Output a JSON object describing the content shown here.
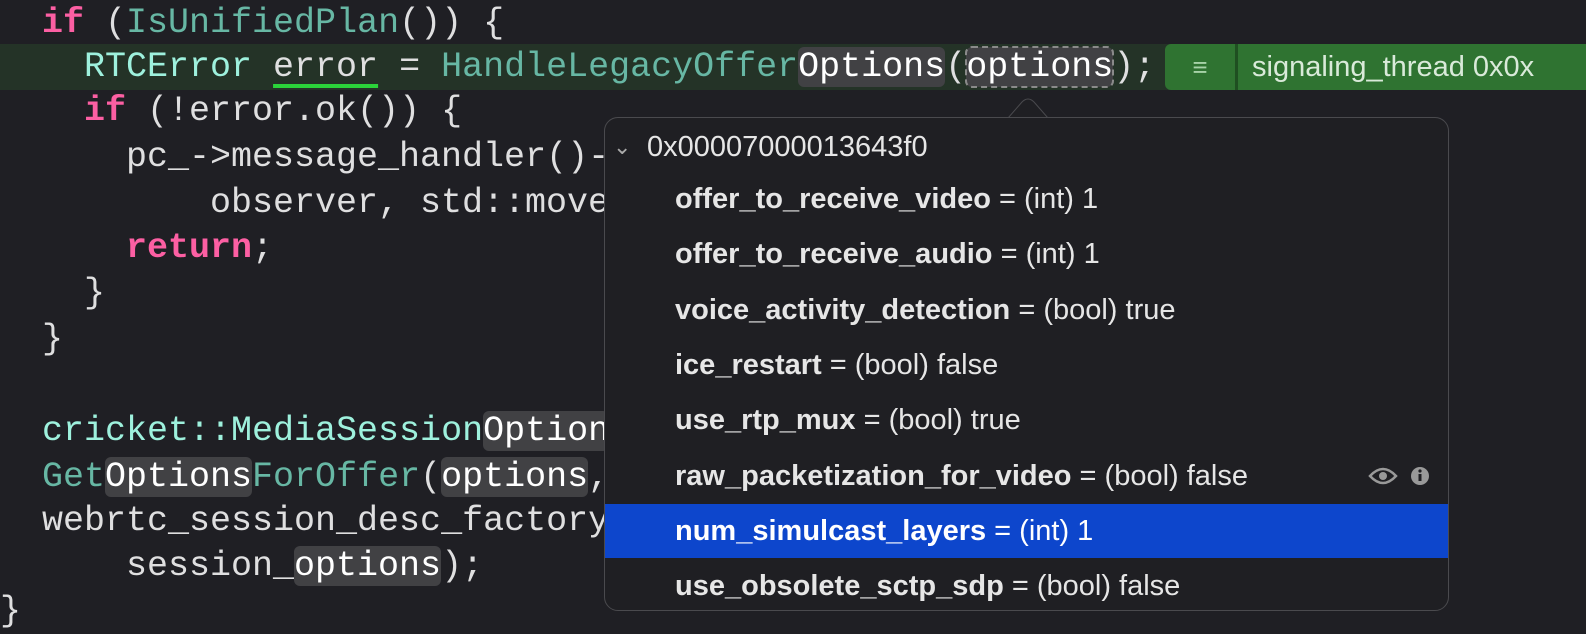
{
  "code": {
    "l1": {
      "kw": "if",
      "a": " (",
      "fn": "IsUnifiedPlan",
      "b": "()) {"
    },
    "l2": {
      "type": "RTCError",
      "var": "error",
      "eq": " = ",
      "fn": "HandleLegacyOffer",
      "tok": "Options",
      "p": "(",
      "arg": "options",
      "end": ");"
    },
    "l3": {
      "kw": "if",
      "rest": " (!error.ok()) {"
    },
    "l4": "pc_->message_handler()-",
    "l5": "observer, std::move",
    "l6": {
      "kw": "return",
      "rest": ";"
    },
    "l7": "}",
    "l8": "}",
    "l9": {
      "type": "cricket::MediaSession",
      "tok": "Option"
    },
    "l10": {
      "fn1": "Get",
      "tok": "Options",
      "fn2": "ForOffer",
      "p": "(",
      "arg": "options",
      "end": ","
    },
    "l11": "webrtc_session_desc_factory",
    "l12": {
      "a": "session_",
      "tok": "options",
      "end": ");"
    },
    "l13": "}"
  },
  "annotation": {
    "icon": "list-icon",
    "text": "signaling_thread 0x0x"
  },
  "popup": {
    "address": "0x00007000013643f0",
    "rows": [
      {
        "name": "offer_to_receive_video",
        "value": " = (int) 1"
      },
      {
        "name": "offer_to_receive_audio",
        "value": " = (int) 1"
      },
      {
        "name": "voice_activity_detection",
        "value": " = (bool) true"
      },
      {
        "name": "ice_restart",
        "value": " = (bool) false"
      },
      {
        "name": "use_rtp_mux",
        "value": " = (bool) true"
      },
      {
        "name": "raw_packetization_for_video",
        "value": " = (bool) false"
      },
      {
        "name": "num_simulcast_layers",
        "value": " = (int) 1"
      },
      {
        "name": "use_obsolete_sctp_sdp",
        "value": " = (bool) false"
      }
    ],
    "selected_index": 6
  },
  "colors": {
    "keyword": "#fc5fa3",
    "function": "#67b7a4",
    "type": "#9ef1dd",
    "selection": "#0d46cc",
    "annotation": "#2f7331"
  }
}
